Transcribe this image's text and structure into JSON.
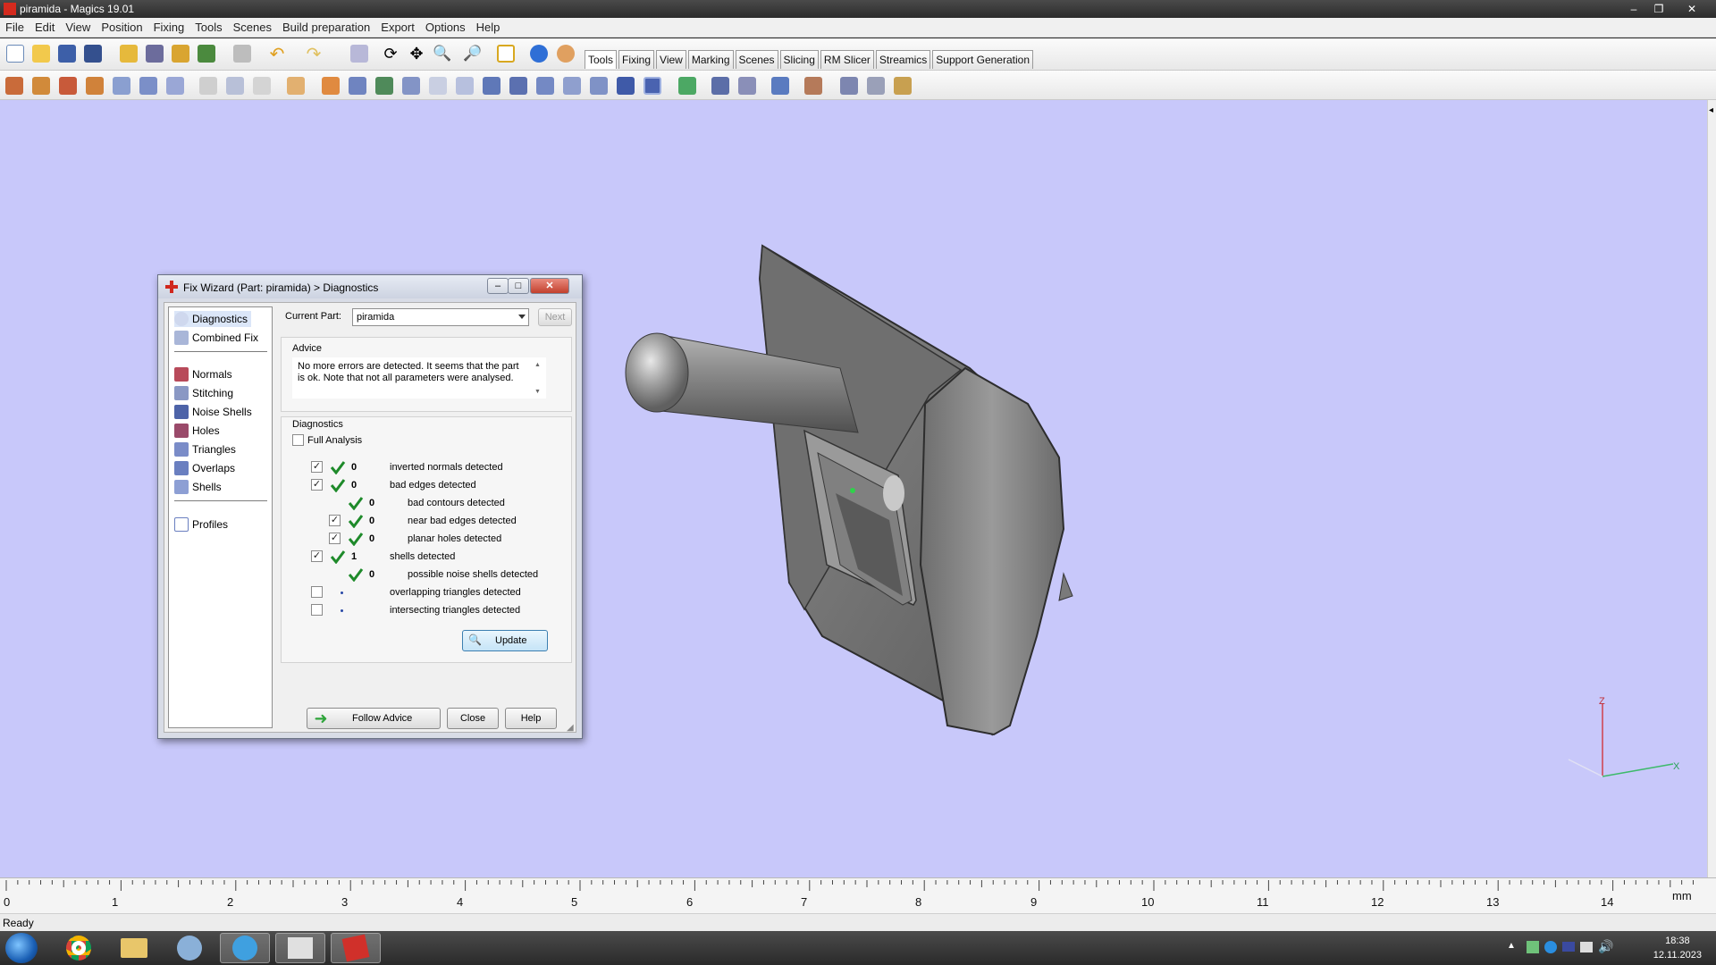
{
  "window": {
    "title": "piramida - Magics 19.01"
  },
  "menu": [
    "File",
    "Edit",
    "View",
    "Position",
    "Fixing",
    "Tools",
    "Scenes",
    "Build preparation",
    "Export",
    "Options",
    "Help"
  ],
  "tabs": [
    {
      "label": "Tools",
      "active": true
    },
    {
      "label": "Fixing",
      "active": false
    },
    {
      "label": "View",
      "active": false
    },
    {
      "label": "Marking",
      "active": false
    },
    {
      "label": "Scenes",
      "active": false
    },
    {
      "label": "Slicing",
      "active": false
    },
    {
      "label": "RM Slicer",
      "active": false
    },
    {
      "label": "Streamics",
      "active": false
    },
    {
      "label": "Support Generation",
      "active": false
    }
  ],
  "dialog": {
    "title": "Fix Wizard (Part: piramida) > Diagnostics",
    "nav": {
      "top": [
        "Diagnostics",
        "Combined Fix"
      ],
      "tools": [
        "Normals",
        "Stitching",
        "Noise Shells",
        "Holes",
        "Triangles",
        "Overlaps",
        "Shells"
      ],
      "bottom": [
        "Profiles"
      ]
    },
    "current_part_label": "Current Part:",
    "current_part_value": "piramida",
    "next_label": "Next",
    "advice_title": "Advice",
    "advice_text": "No more errors are detected. It seems that the part is ok. Note that not all parameters were analysed.",
    "diagnostics_title": "Diagnostics",
    "full_analysis_label": "Full Analysis",
    "rows": [
      {
        "label": "inverted normals detected",
        "count": "0",
        "checked": true,
        "ok": true,
        "indent": 0,
        "has_checkbox": true
      },
      {
        "label": "bad edges detected",
        "count": "0",
        "checked": true,
        "ok": true,
        "indent": 0,
        "has_checkbox": true
      },
      {
        "label": "bad contours detected",
        "count": "0",
        "checked": false,
        "ok": true,
        "indent": 1,
        "has_checkbox": false
      },
      {
        "label": "near bad edges detected",
        "count": "0",
        "checked": true,
        "ok": true,
        "indent": 1,
        "has_checkbox": true
      },
      {
        "label": "planar holes detected",
        "count": "0",
        "checked": true,
        "ok": true,
        "indent": 1,
        "has_checkbox": true
      },
      {
        "label": "shells detected",
        "count": "1",
        "checked": true,
        "ok": true,
        "indent": 0,
        "has_checkbox": true
      },
      {
        "label": "possible noise shells detected",
        "count": "0",
        "checked": false,
        "ok": true,
        "indent": 1,
        "has_checkbox": false
      },
      {
        "label": "overlapping triangles detected",
        "count": "",
        "checked": false,
        "ok": false,
        "indent": 0,
        "has_checkbox": true
      },
      {
        "label": "intersecting triangles detected",
        "count": "",
        "checked": false,
        "ok": false,
        "indent": 0,
        "has_checkbox": true
      }
    ],
    "update_label": "Update",
    "follow_advice_label": "Follow Advice",
    "close_label": "Close",
    "help_label": "Help"
  },
  "axes": {
    "z": "Z",
    "x": "X"
  },
  "ruler": {
    "labels": [
      "0",
      "1",
      "2",
      "3",
      "4",
      "5",
      "6",
      "7",
      "8",
      "9",
      "10",
      "11",
      "12",
      "13",
      "14"
    ],
    "unit": "mm"
  },
  "status": "Ready",
  "clock": {
    "time": "18:38",
    "date": "12.11.2023"
  },
  "colors": {
    "viewport": "#c8c8fa",
    "ok_check": "#1e8a2a",
    "part": "#7a7a7a"
  }
}
